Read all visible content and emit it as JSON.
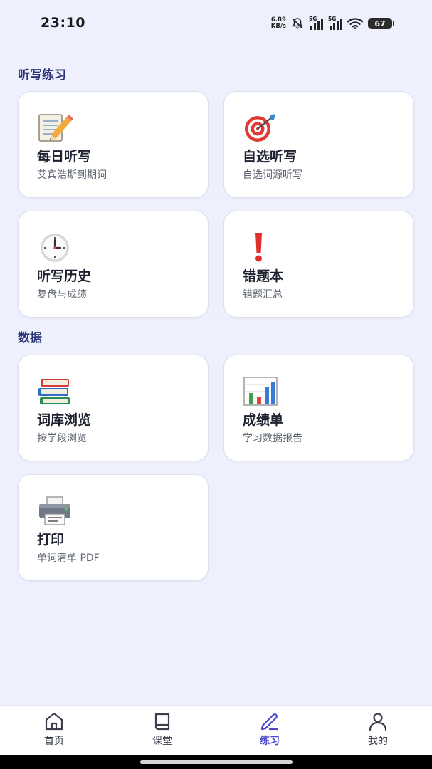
{
  "status_bar": {
    "time": "23:10",
    "net_speed_value": "6.89",
    "net_speed_unit": "KB/s",
    "sim1_label": "5G",
    "sim2_label": "5G",
    "battery": "67"
  },
  "sections": {
    "dictation": {
      "title": "听写练习"
    },
    "data": {
      "title": "数据"
    }
  },
  "cards": {
    "daily": {
      "icon": "memo-icon",
      "title": "每日听写",
      "subtitle": "艾宾浩斯到期词"
    },
    "custom": {
      "icon": "target-icon",
      "title": "自选听写",
      "subtitle": "自选词源听写"
    },
    "history": {
      "icon": "clock-icon",
      "title": "听写历史",
      "subtitle": "复盘与成绩"
    },
    "mistakes": {
      "icon": "exclamation-icon",
      "title": "错题本",
      "subtitle": "错题汇总"
    },
    "library": {
      "icon": "books-icon",
      "title": "词库浏览",
      "subtitle": "按学段浏览"
    },
    "report": {
      "icon": "bar-chart-icon",
      "title": "成绩单",
      "subtitle": "学习数据报告"
    },
    "print": {
      "icon": "printer-icon",
      "title": "打印",
      "subtitle": "单词清单 PDF"
    }
  },
  "bottom_nav": {
    "items": [
      {
        "label": "首页",
        "icon": "home-icon",
        "active": false
      },
      {
        "label": "课堂",
        "icon": "book-icon",
        "active": false
      },
      {
        "label": "练习",
        "icon": "pencil-icon",
        "active": true
      },
      {
        "label": "我的",
        "icon": "user-icon",
        "active": false
      }
    ],
    "active_color": "#4b45c9"
  },
  "colors": {
    "background": "#eff0fd",
    "section_title": "#2a3277",
    "card_background": "#ffffff"
  }
}
